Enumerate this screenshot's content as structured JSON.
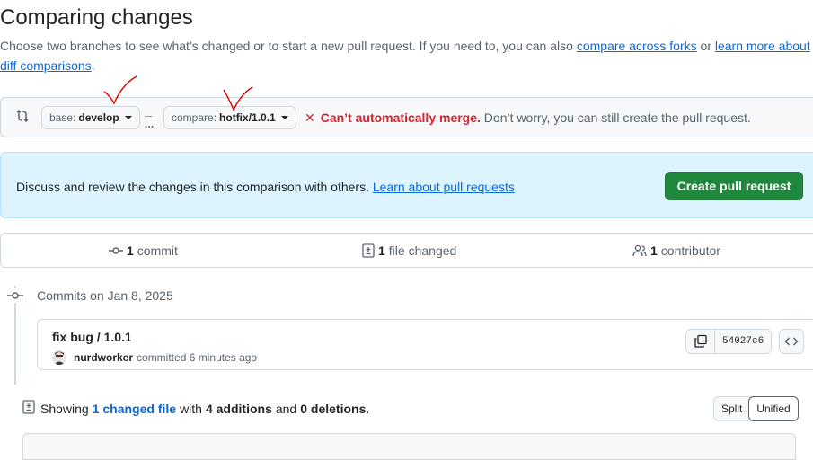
{
  "page": {
    "title": "Comparing changes",
    "desc_prefix": "Choose two branches to see what’s changed or to start a new pull request. If you need to, you can also ",
    "link_compare_forks": "compare across forks",
    "desc_or": " or ",
    "link_learn_diff": "learn more about diff comparisons",
    "desc_suffix": "."
  },
  "range": {
    "base_label": "base:",
    "base_value": "develop",
    "compare_label": "compare:",
    "compare_value": "hotfix/1.0.1",
    "merge_status_strong": "Can’t automatically merge.",
    "merge_status_rest": " Don’t worry, you can still create the pull request."
  },
  "info": {
    "text": "Discuss and review the changes in this comparison with others. ",
    "link": "Learn about pull requests",
    "create_button": "Create pull request"
  },
  "stats": {
    "commits_count": "1",
    "commits_label": "commit",
    "files_count": "1",
    "files_label": "file changed",
    "contributors_count": "1",
    "contributors_label": "contributor"
  },
  "commits": {
    "date_heading": "Commits on Jan 8, 2025",
    "items": [
      {
        "title": "fix bug / 1.0.1",
        "author": "nurdworker",
        "action": "committed",
        "time": "6 minutes ago",
        "sha": "54027c6"
      }
    ]
  },
  "diff_summary": {
    "showing": "Showing",
    "changed_files_link": "1 changed file",
    "with": "with",
    "additions": "4 additions",
    "and": "and",
    "deletions": "0 deletions",
    "period": "."
  },
  "view_toggle": {
    "split": "Split",
    "unified": "Unified",
    "selected": "Unified"
  },
  "colors": {
    "accent": "#0969da",
    "success": "#1f883d",
    "danger": "#d1242f",
    "annotation": "#e00000"
  }
}
